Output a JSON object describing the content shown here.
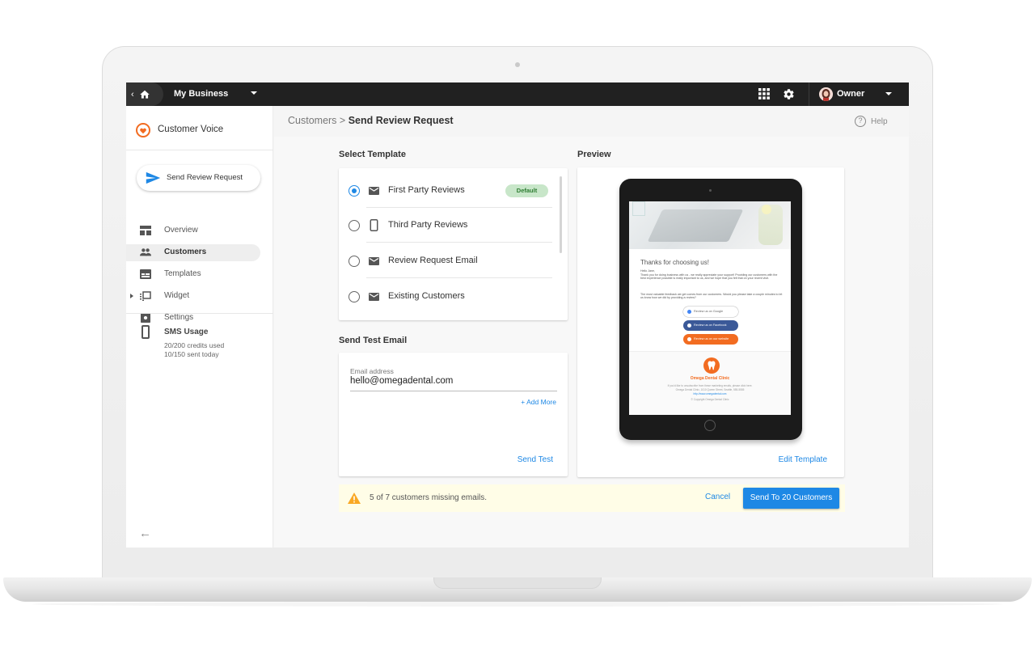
{
  "topbar": {
    "business": "My Business",
    "owner": "Owner"
  },
  "sidebar": {
    "app_name": "Customer Voice",
    "cta": "Send Review Request",
    "items": [
      {
        "label": "Overview",
        "icon": "overview-icon"
      },
      {
        "label": "Customers",
        "icon": "customers-icon",
        "active": true
      },
      {
        "label": "Templates",
        "icon": "templates-icon"
      },
      {
        "label": "Widget",
        "icon": "widget-icon"
      },
      {
        "label": "Settings",
        "icon": "settings-icon"
      }
    ],
    "sms": {
      "title": "SMS Usage",
      "credits": "20/200 credits used",
      "sent": "10/150 sent today"
    }
  },
  "header": {
    "crumb_parent": "Customers",
    "crumb_sep": " > ",
    "crumb_current": "Send Review Request",
    "help": "Help"
  },
  "templates": {
    "title": "Select Template",
    "items": [
      {
        "label": "First Party Reviews",
        "icon": "mail-icon",
        "selected": true,
        "badge": "Default"
      },
      {
        "label": "Third Party Reviews",
        "icon": "phone-icon",
        "selected": false
      },
      {
        "label": "Review Request Email",
        "icon": "mail-icon",
        "selected": false
      },
      {
        "label": "Existing Customers",
        "icon": "mail-icon",
        "selected": false
      }
    ]
  },
  "test_email": {
    "title": "Send Test Email",
    "field_label": "Email address",
    "value": "hello@omegadental.com",
    "add_more": "+ Add More",
    "send": "Send Test"
  },
  "preview": {
    "title": "Preview",
    "edit": "Edit Template",
    "email": {
      "thanks": "Thanks for choosing us!",
      "greeting": "Hello Jane,",
      "body1": "Thank you for doing business with us - we really appreciate your support! Providing our customers with the best experience possible is really important to us, and we hope that you felt that on your recent visit.",
      "body2": "The most valuable feedback we get comes from our customers. Would you please take a couple minutes to let us know how we did by providing a review?",
      "btn_google": "Review us on Google",
      "btn_facebook": "Review us on Facebook",
      "btn_website": "Review us on our website",
      "clinic": "Omega Dental Clinic",
      "fine1": "If you'd like to unsubscribe from these marketing emails, please click here.",
      "fine2": "Omega Dental Clinic, 1010 Queen Street, Seattle, 555-5555",
      "link": "http://www.omegadental.com",
      "copyright": "© Copyright Omega Dental Clinic"
    }
  },
  "footer": {
    "alert": "5 of 7 customers missing emails.",
    "cancel": "Cancel",
    "send": "Send To 20 Customers"
  },
  "colors": {
    "accent": "#1e88e5",
    "brand_orange": "#f26c21",
    "topbar": "#212121"
  }
}
